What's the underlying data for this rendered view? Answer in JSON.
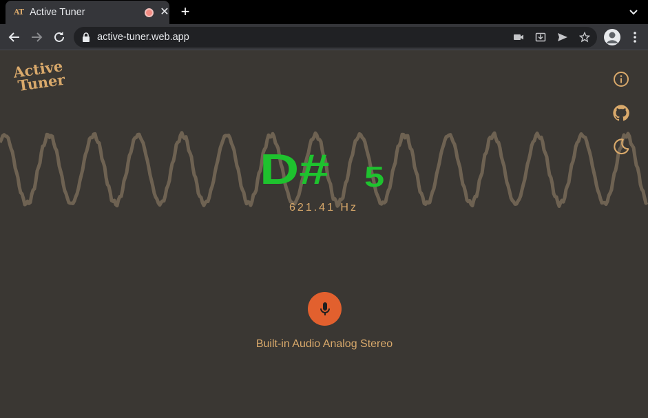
{
  "browser": {
    "tab": {
      "favicon_text": "AT",
      "title": "Active Tuner",
      "close_glyph": "✕"
    },
    "new_tab_glyph": "+",
    "url": "active-tuner.web.app"
  },
  "app": {
    "logo": {
      "line1": "Active",
      "line2": "Tuner"
    },
    "note": {
      "letter": "D#",
      "octave": "5"
    },
    "frequency": "621.41 Hz",
    "device_label": "Built-in Audio Analog Stereo",
    "icons": {
      "info": "info-icon",
      "github": "github-icon",
      "theme": "moon-icon",
      "mic": "microphone-icon"
    },
    "colors": {
      "background": "#3a3733",
      "accent": "#d9a96b",
      "note": "#1ec22e",
      "mic_button": "#e2602e",
      "waveform": "#6e6252"
    }
  }
}
